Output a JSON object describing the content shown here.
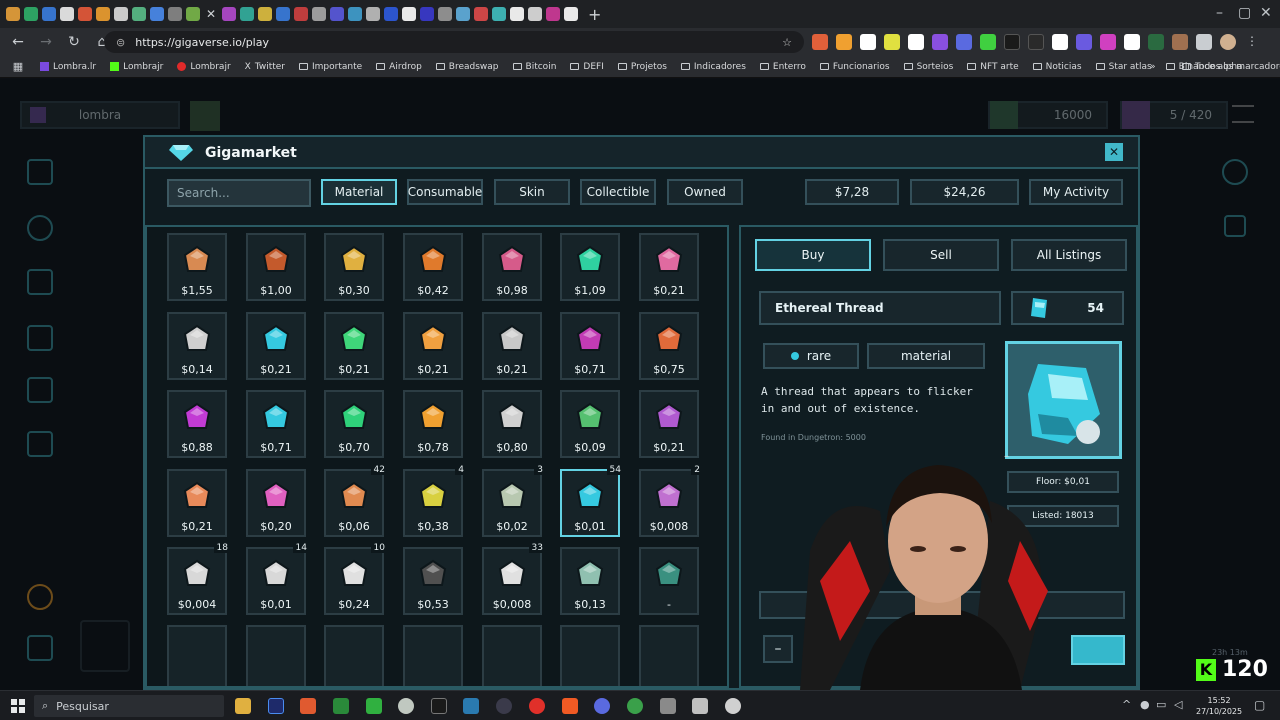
{
  "browser": {
    "url": "https://gigaverse.io/play",
    "bookmarks": [
      "Lombra.lr",
      "Lombrajr",
      "Lombrajr",
      "Twitter",
      "Importante",
      "Airdrop",
      "Breadswap",
      "Bitcoin",
      "DEFI",
      "Projetos",
      "Indicadores",
      "Enterro",
      "Funcionarios",
      "Sorteios",
      "NFT arte",
      "Noticias",
      "Star atlas",
      "Binance alpha"
    ],
    "all_bookmarks": "Todos os marcadores"
  },
  "hud": {
    "player": "lombra",
    "energy": "16000",
    "capacity": "5 / 420"
  },
  "market": {
    "title": "Gigamarket",
    "search_placeholder": "Search...",
    "tabs": [
      "Material",
      "Consumable",
      "Skin",
      "Collectible",
      "Owned"
    ],
    "active_tab": "Material",
    "balance_1": "$7,28",
    "balance_2": "$24,26",
    "my_activity": "My Activity",
    "items": [
      {
        "price": "$1,55",
        "color": "#d88a52"
      },
      {
        "price": "$1,00",
        "color": "#c45a2c"
      },
      {
        "price": "$0,30",
        "color": "#e0b040"
      },
      {
        "price": "$0,42",
        "color": "#e07a2c"
      },
      {
        "price": "$0,98",
        "color": "#d65b8a"
      },
      {
        "price": "$1,09",
        "color": "#2fd1a0"
      },
      {
        "price": "$0,21",
        "color": "#e06aa0"
      },
      {
        "price": "$0,14",
        "color": "#cfcfcf"
      },
      {
        "price": "$0,21",
        "color": "#35c9e0"
      },
      {
        "price": "$0,21",
        "color": "#3fd67a"
      },
      {
        "price": "$0,21",
        "color": "#f0a040"
      },
      {
        "price": "$0,21",
        "color": "#c8c8c8"
      },
      {
        "price": "$0,71",
        "color": "#c23bb4"
      },
      {
        "price": "$0,75",
        "color": "#e06a3a"
      },
      {
        "price": "$0,88",
        "color": "#c23bd4"
      },
      {
        "price": "$0,71",
        "color": "#35c9e0"
      },
      {
        "price": "$0,70",
        "color": "#2fd17a"
      },
      {
        "price": "$0,78",
        "color": "#f0a030"
      },
      {
        "price": "$0,80",
        "color": "#d0d0d0"
      },
      {
        "price": "$0,09",
        "color": "#55c070"
      },
      {
        "price": "$0,21",
        "color": "#b05ad0"
      },
      {
        "price": "$0,21",
        "color": "#e88a5a",
        "qty": ""
      },
      {
        "price": "$0,20",
        "color": "#e060c0",
        "qty": ""
      },
      {
        "price": "$0,06",
        "color": "#e08a50",
        "qty": "42"
      },
      {
        "price": "$0,38",
        "color": "#d8d040",
        "qty": "4"
      },
      {
        "price": "$0,02",
        "color": "#b8c8b0",
        "qty": "3"
      },
      {
        "price": "$0,01",
        "color": "#35c9e0",
        "qty": "54"
      },
      {
        "price": "$0,008",
        "color": "#c070d0",
        "qty": "2"
      },
      {
        "price": "$0,004",
        "color": "#d8d8d8",
        "qty": "18"
      },
      {
        "price": "$0,01",
        "color": "#d8d8d8",
        "qty": "14"
      },
      {
        "price": "$0,24",
        "color": "#e0e0e0",
        "qty": "10"
      },
      {
        "price": "$0,53",
        "color": "#505050",
        "qty": ""
      },
      {
        "price": "$0,008",
        "color": "#e0e0e0",
        "qty": "33"
      },
      {
        "price": "$0,13",
        "color": "#90c0b0",
        "qty": ""
      },
      {
        "price": "-",
        "color": "#3a9080",
        "qty": ""
      }
    ],
    "detail": {
      "buy": "Buy",
      "sell": "Sell",
      "all_listings": "All Listings",
      "item_name": "Ethereal Thread",
      "item_count": "54",
      "rarity": "rare",
      "category": "material",
      "description": "A thread that appears to flicker in and out of existence.",
      "found": "Found in Dungetron: 5000",
      "floor": "Floor: $0,01",
      "listed": "Listed: 18013",
      "minus": "–"
    }
  },
  "overlay": {
    "viewers": "120",
    "timer": "23h 13m"
  },
  "taskbar": {
    "search": "Pesquisar",
    "time": "15:52",
    "date": "27/10/2025"
  }
}
